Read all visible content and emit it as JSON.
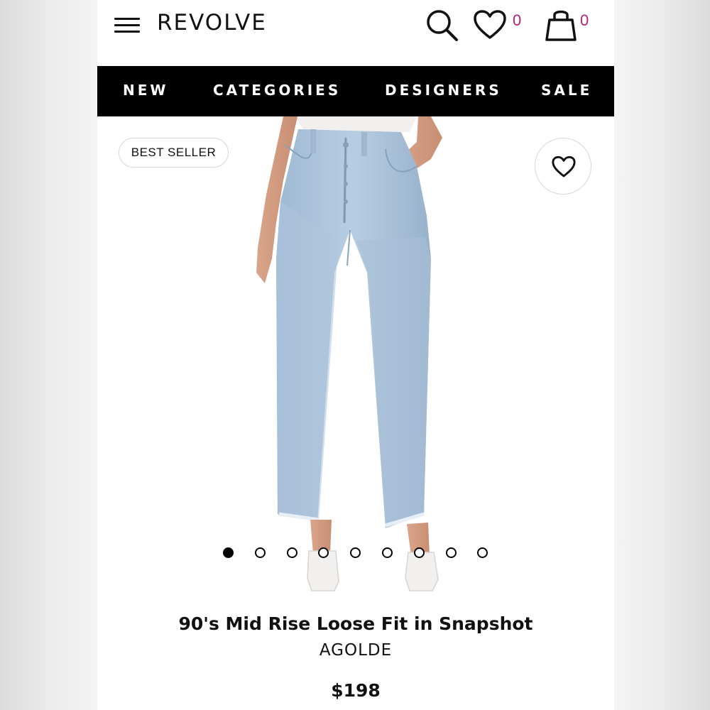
{
  "header": {
    "logo": "REVOLVE",
    "wishlist_count": "0",
    "bag_count": "0",
    "icons": [
      "menu-icon",
      "search-icon",
      "heart-icon",
      "shopping-bag-icon"
    ]
  },
  "nav": {
    "items": [
      {
        "label": "NEW"
      },
      {
        "label": "CATEGORIES"
      },
      {
        "label": "DESIGNERS"
      },
      {
        "label": "SALE"
      }
    ]
  },
  "product": {
    "badge": "BEST SELLER",
    "name": "90's Mid Rise Loose Fit in Snapshot",
    "brand": "AGOLDE",
    "price": "$198",
    "image_count": 9,
    "active_image": 1
  },
  "colors": {
    "nav_background": "#000000",
    "count_accent": "#b5247a",
    "denim": "#a9c3dc"
  }
}
